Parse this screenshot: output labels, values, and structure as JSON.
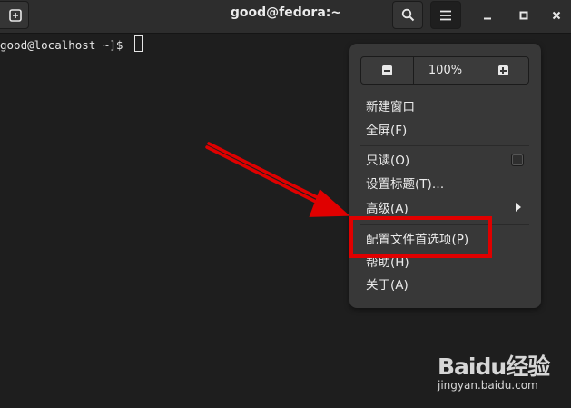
{
  "window": {
    "title": "good@fedora:~"
  },
  "terminal": {
    "prompt": "good@localhost ~]$"
  },
  "menu": {
    "zoom": "100%",
    "items": {
      "new_window": "新建窗口",
      "fullscreen": "全屏(F)",
      "readonly": "只读(O)",
      "set_title": "设置标题(T)…",
      "advanced": "高级(A)",
      "preferences": "配置文件首选项(P)",
      "help": "帮助(H)",
      "about": "关于(A)"
    },
    "readonly_checked": false
  },
  "icons": {
    "new_tab": "new-tab-icon",
    "search": "search-icon",
    "menu": "hamburger-menu-icon",
    "minimize": "minimize-icon",
    "maximize": "maximize-icon",
    "close": "close-icon",
    "zoom_out": "zoom-out-icon",
    "zoom_in": "zoom-in-icon",
    "submenu": "submenu-arrow-icon"
  },
  "annotation": {
    "color": "#e00000"
  },
  "watermark": {
    "logo": "Baidu经验",
    "url": "jingyan.baidu.com"
  }
}
